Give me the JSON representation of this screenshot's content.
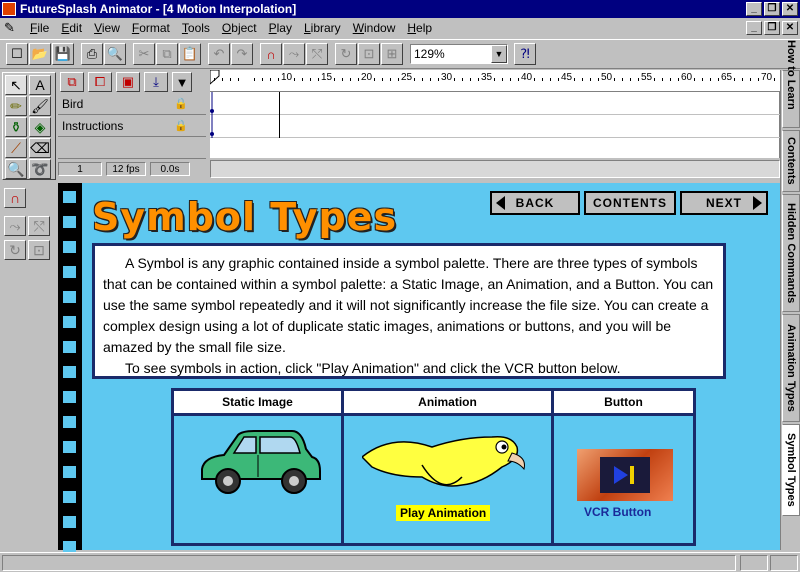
{
  "window": {
    "title": "FutureSplash Animator - [4 Motion Interpolation]",
    "caption_buttons": [
      "_",
      "❐",
      "✕"
    ]
  },
  "menu": {
    "items": [
      {
        "underline": "F",
        "rest": "ile"
      },
      {
        "underline": "E",
        "rest": "dit"
      },
      {
        "underline": "V",
        "rest": "iew"
      },
      {
        "underline": "F",
        "rest": "ormat"
      },
      {
        "underline": "T",
        "rest": "ools"
      },
      {
        "underline": "O",
        "rest": "bject"
      },
      {
        "underline": "P",
        "rest": "lay"
      },
      {
        "underline": "L",
        "rest": "ibrary"
      },
      {
        "underline": "W",
        "rest": "indow"
      },
      {
        "underline": "H",
        "rest": "elp"
      }
    ]
  },
  "toolbar": {
    "zoom_value": "129%"
  },
  "timeline": {
    "layers": [
      {
        "name": "Bird"
      },
      {
        "name": "Instructions"
      },
      {
        "name": ""
      }
    ],
    "ruler_labels": [
      "5",
      "10",
      "15",
      "20",
      "25",
      "30",
      "35",
      "40",
      "45",
      "50",
      "55",
      "60",
      "65",
      "70"
    ],
    "status": {
      "frame": "1",
      "fps": "12 fps",
      "time": "0.0s"
    }
  },
  "side_tabs": [
    {
      "label": "How to Learn",
      "active": false
    },
    {
      "label": "Contents",
      "active": false
    },
    {
      "label": "Hidden Commands",
      "active": false
    },
    {
      "label": "Animation Types",
      "active": false
    },
    {
      "label": "Symbol Types",
      "active": true
    }
  ],
  "stage": {
    "title": "Symbol Types",
    "nav": {
      "back": "BACK",
      "contents": "CONTENTS",
      "next": "NEXT"
    },
    "description_p1": "A Symbol is any graphic contained inside a symbol palette. There are three types of symbols that can be contained within a symbol palette: a Static Image, an Animation, and a Button. You can use the same symbol repeatedly and it will not significantly increase the file size. You can create a complex design using a lot of duplicate static images, animations or buttons, and you will be amazed by the small file size.",
    "description_p2": "To see symbols in action, click \"Play Animation\" and click the VCR button below.",
    "table": {
      "headers": [
        "Static Image",
        "Animation",
        "Button"
      ],
      "play_label": "Play Animation",
      "vcr_label": "VCR Button"
    }
  },
  "colors": {
    "stage_bg": "#5ec8f0",
    "title_orange": "#ff9000",
    "border_navy": "#1a2a6a",
    "titlebar": "#000080"
  }
}
